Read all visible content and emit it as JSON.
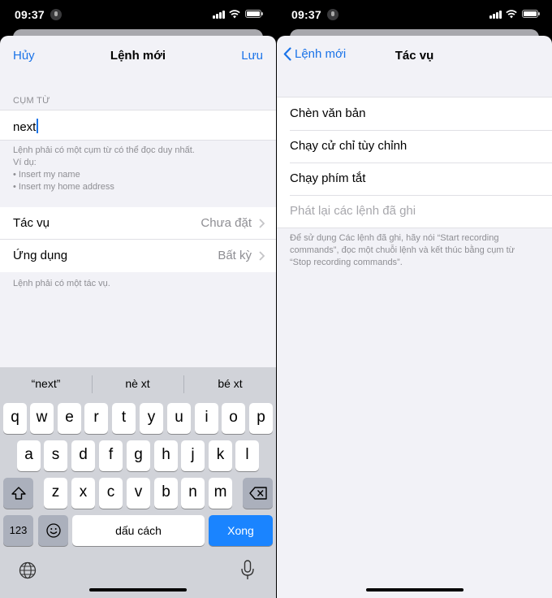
{
  "status": {
    "time": "09:37"
  },
  "left": {
    "nav": {
      "cancel": "Hủy",
      "title": "Lệnh mới",
      "save": "Lưu"
    },
    "phrase_section": "CỤM TỪ",
    "phrase_value": "next",
    "phrase_note": [
      "Lệnh phải có một cụm từ có thể đọc duy nhất.",
      "Ví dụ:",
      "• Insert my name",
      "• Insert my home address"
    ],
    "rows": [
      {
        "label": "Tác vụ",
        "value": "Chưa đặt"
      },
      {
        "label": "Ứng dụng",
        "value": "Bất kỳ"
      }
    ],
    "action_note": "Lệnh phải có một tác vụ.",
    "keyboard": {
      "suggestions": [
        "“next”",
        "nè xt",
        "bé xt"
      ],
      "row1": [
        "q",
        "w",
        "e",
        "r",
        "t",
        "y",
        "u",
        "i",
        "o",
        "p"
      ],
      "row2": [
        "a",
        "s",
        "d",
        "f",
        "g",
        "h",
        "j",
        "k",
        "l"
      ],
      "row3": [
        "z",
        "x",
        "c",
        "v",
        "b",
        "n",
        "m"
      ],
      "numbers": "123",
      "space": "dấu cách",
      "done": "Xong"
    }
  },
  "right": {
    "nav": {
      "back": "Lệnh mới",
      "title": "Tác vụ"
    },
    "items": [
      {
        "label": "Chèn văn bản"
      },
      {
        "label": "Chạy cử chỉ tùy chỉnh"
      },
      {
        "label": "Chạy phím tắt"
      },
      {
        "label": "Phát lại các lệnh đã ghi"
      }
    ],
    "note": [
      "Để sử dụng Các lệnh đã ghi, hãy nói “Start recording",
      "commands”, đọc một chuỗi lệnh và kết thúc bằng cụm từ",
      "“Stop recording commands”."
    ]
  },
  "icons": [
    "microphone-indicator-icon",
    "cellular-signal-icon",
    "wifi-icon",
    "battery-icon",
    "chevron-right-icon",
    "chevron-left-icon",
    "shift-icon",
    "backspace-icon",
    "emoji-icon",
    "globe-icon",
    "dictation-microphone-icon"
  ],
  "colors": {
    "accent": "#1a73e8",
    "keyboard_done": "#1a84ff",
    "background": "#f2f2f7"
  }
}
